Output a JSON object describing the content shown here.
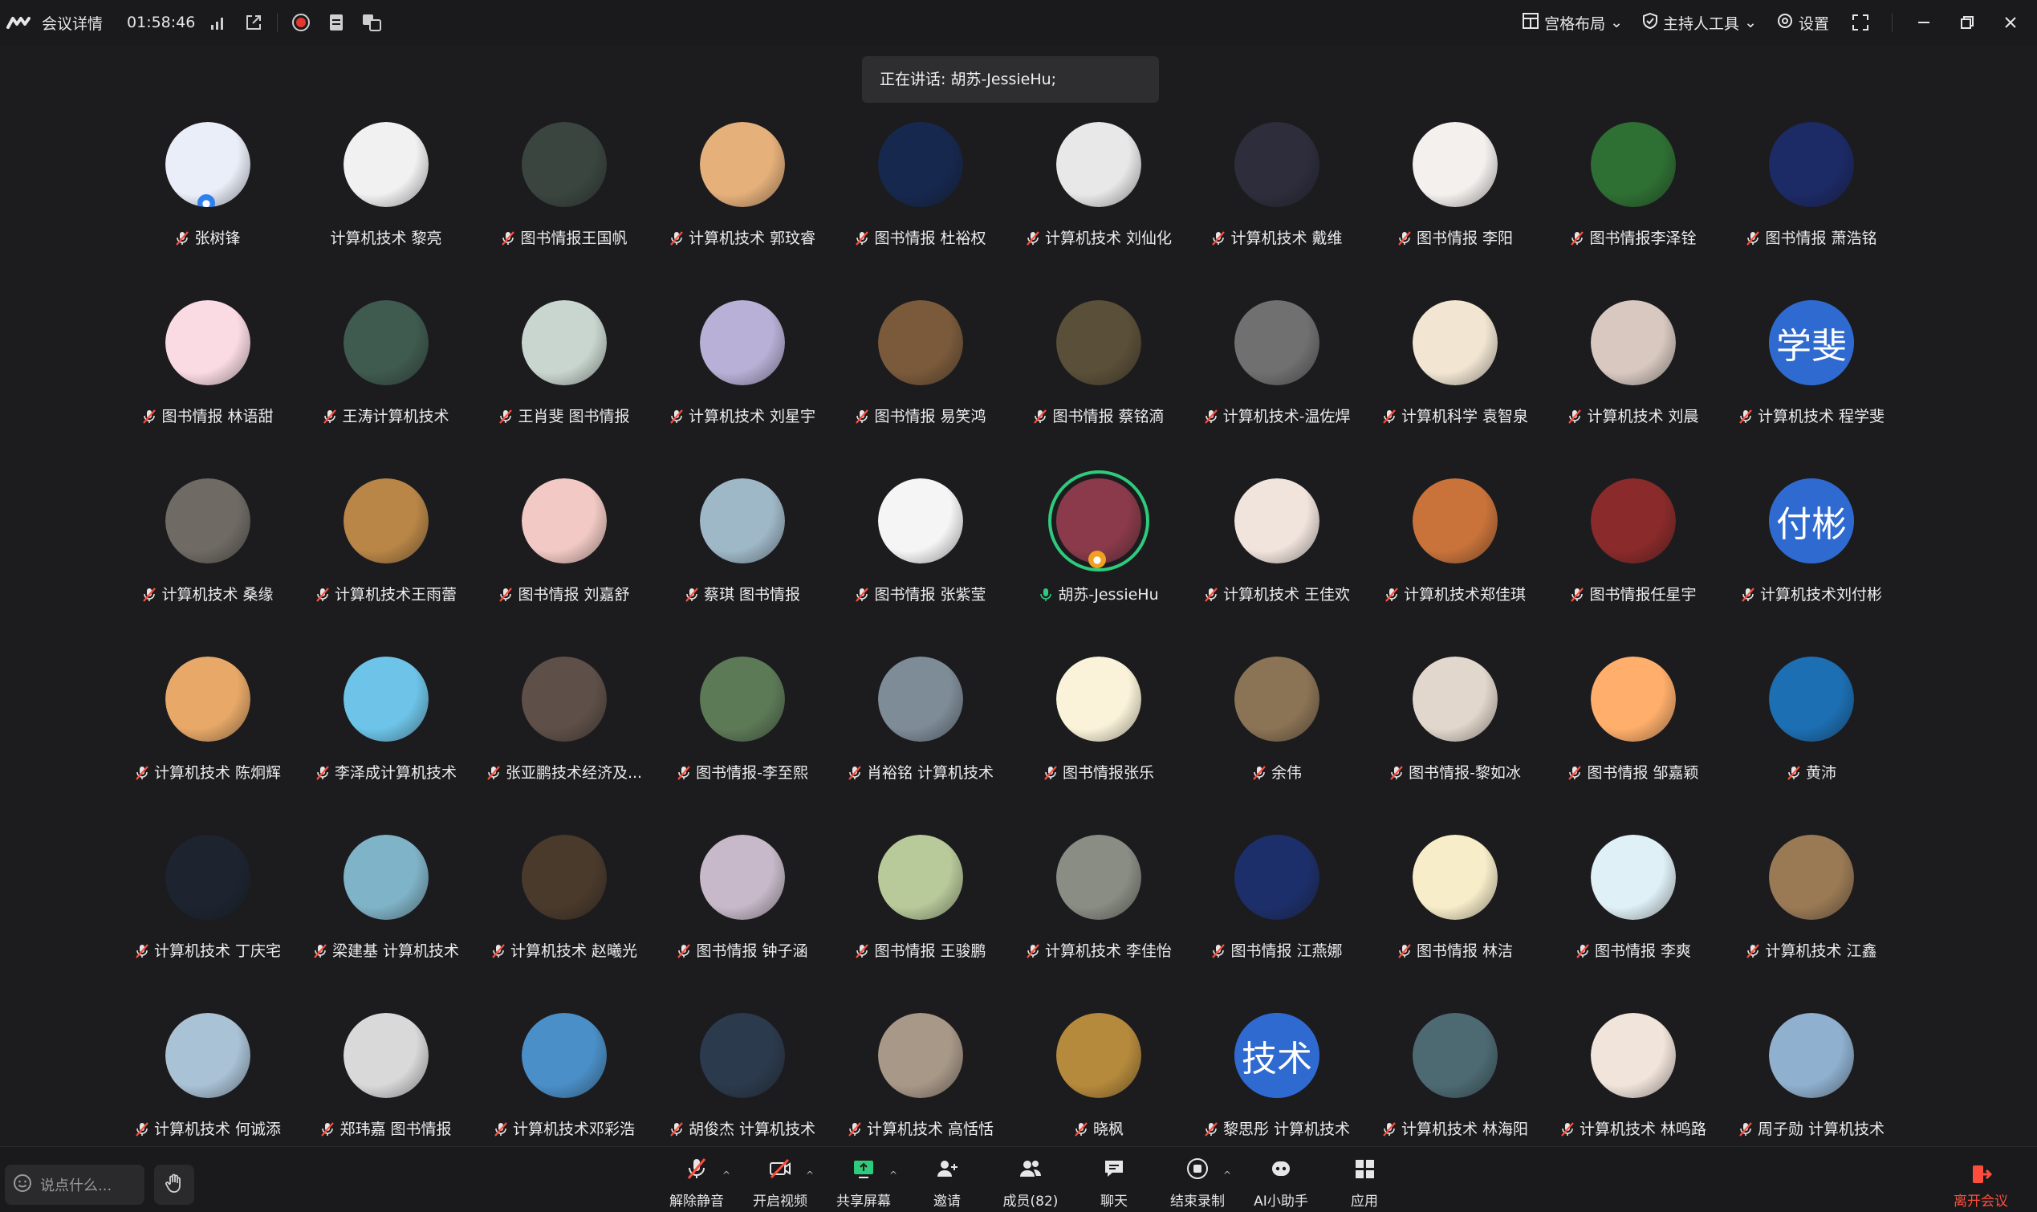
{
  "topbar": {
    "meeting_details": "会议详情",
    "timer": "01:58:46",
    "layout": "宫格布局",
    "host_tools": "主持人工具",
    "settings": "设置"
  },
  "speaking": "正在讲话: 胡苏-JessieHu;",
  "participants": [
    {
      "name": "张树锋",
      "avatar": "cat-pattern",
      "color": "#e9eef8",
      "muted": true,
      "host": true
    },
    {
      "name": "计算机技术 黎亮",
      "avatar": "sketch",
      "color": "#f1f1f1",
      "muted": false
    },
    {
      "name": "图书情报王国帆",
      "avatar": "photo",
      "color": "#3a4540",
      "muted": true
    },
    {
      "name": "计算机技术 郭玟睿",
      "avatar": "anime",
      "color": "#e6b07a",
      "muted": true
    },
    {
      "name": "图书情报 杜裕权",
      "avatar": "photo",
      "color": "#16284e",
      "muted": true
    },
    {
      "name": "计算机技术 刘仙化",
      "avatar": "duck",
      "color": "#e8e8e8",
      "muted": true
    },
    {
      "name": "计算机技术 戴维",
      "avatar": "robot",
      "color": "#2d2d3c",
      "muted": true
    },
    {
      "name": "图书情报 李阳",
      "avatar": "anime",
      "color": "#f3f0ee",
      "muted": true
    },
    {
      "name": "图书情报李泽铨",
      "avatar": "lotus",
      "color": "#2e6f33",
      "muted": true
    },
    {
      "name": "图书情报 萧浩铭",
      "avatar": "night",
      "color": "#1c2a66",
      "muted": true
    },
    {
      "name": "图书情报 林语甜",
      "avatar": "rabbit",
      "color": "#fbdbe3",
      "muted": true
    },
    {
      "name": "王涛计算机技术",
      "avatar": "panda",
      "color": "#3f5a4f",
      "muted": true
    },
    {
      "name": "王肖斐 图书情报",
      "avatar": "photo",
      "color": "#c9d6cf",
      "muted": true
    },
    {
      "name": "计算机技术 刘星宇",
      "avatar": "anime",
      "color": "#b8b0d6",
      "muted": true
    },
    {
      "name": "图书情报 易笑鸿",
      "avatar": "photo",
      "color": "#7a5a3b",
      "muted": true
    },
    {
      "name": "图书情报   蔡铭滴",
      "avatar": "photo",
      "color": "#5a4f38",
      "muted": true
    },
    {
      "name": "计算机技术-温佐焊",
      "avatar": "rail",
      "color": "#707070",
      "muted": true
    },
    {
      "name": "计算机科学 袁智泉",
      "avatar": "cartoon",
      "color": "#f2e6d3",
      "muted": true
    },
    {
      "name": "计算机技术 刘晨",
      "avatar": "photo",
      "color": "#d8c8c0",
      "muted": true
    },
    {
      "name": "计算机技术 程学斐",
      "avatar": "text",
      "text": "学斐",
      "color": "#2f6ad1",
      "muted": true
    },
    {
      "name": "计算机技术 桑缘",
      "avatar": "photo",
      "color": "#6f6a64",
      "muted": true
    },
    {
      "name": "计算机技术王雨蕾",
      "avatar": "bear",
      "color": "#b98647",
      "muted": true
    },
    {
      "name": "图书情报 刘嘉舒",
      "avatar": "baby",
      "color": "#f2c9c4",
      "muted": true
    },
    {
      "name": "蔡琪 图书情报",
      "avatar": "cat",
      "color": "#9fb8c8",
      "muted": true
    },
    {
      "name": "图书情报 张紫莹",
      "avatar": "tiger",
      "color": "#f5f5f5",
      "muted": true
    },
    {
      "name": "胡苏-JessieHu",
      "avatar": "photo",
      "color": "#8a3a4a",
      "muted": false,
      "active": true
    },
    {
      "name": "计算机技术 王佳欢",
      "avatar": "baby",
      "color": "#f1e4dd",
      "muted": true
    },
    {
      "name": "计算机技术郑佳琪",
      "avatar": "food",
      "color": "#c9733a",
      "muted": true
    },
    {
      "name": "图书情报任星宇",
      "avatar": "photo",
      "color": "#8a2a2a",
      "muted": true
    },
    {
      "name": "计算机技术刘付彬",
      "avatar": "text",
      "text": "付彬",
      "color": "#2f6ad1",
      "muted": true
    },
    {
      "name": "计算机技术 陈炯辉",
      "avatar": "cookie",
      "color": "#e7a868",
      "muted": true
    },
    {
      "name": "李泽成计算机技术",
      "avatar": "cartoon",
      "color": "#6dc4e8",
      "muted": true
    },
    {
      "name": "张亚鹏技术经济及...",
      "avatar": "photo",
      "color": "#5e5048",
      "muted": true
    },
    {
      "name": "图书情报-李至熙",
      "avatar": "photo",
      "color": "#5d7a57",
      "muted": true
    },
    {
      "name": "肖裕铭 计算机技术",
      "avatar": "cat",
      "color": "#7e8c97",
      "muted": true
    },
    {
      "name": "图书情报张乐",
      "avatar": "rabbit",
      "color": "#fbf3d9",
      "muted": true
    },
    {
      "name": "余伟",
      "avatar": "photo",
      "color": "#8b7355",
      "muted": true
    },
    {
      "name": "图书情报-黎如冰",
      "avatar": "photo",
      "color": "#e2d7cc",
      "muted": true
    },
    {
      "name": "图书情报 邹嘉颖",
      "avatar": "dog",
      "color": "#ffae6b",
      "muted": true
    },
    {
      "name": "黄沛",
      "avatar": "cartoon",
      "color": "#1c6fb3",
      "muted": true
    },
    {
      "name": "计算机技术 丁庆宅",
      "avatar": "photo",
      "color": "#1d2430",
      "muted": true
    },
    {
      "name": "梁建基 计算机技术",
      "avatar": "cloud",
      "color": "#7fb3c7",
      "muted": true
    },
    {
      "name": "计算机技术 赵曦光",
      "avatar": "dog",
      "color": "#4a3a2c",
      "muted": true
    },
    {
      "name": "图书情报 钟子涵",
      "avatar": "anime",
      "color": "#c7b9c9",
      "muted": true
    },
    {
      "name": "图书情报 王骏鹏",
      "avatar": "dog",
      "color": "#b8c99a",
      "muted": true
    },
    {
      "name": "计算机技术 李佳怡",
      "avatar": "photo",
      "color": "#8a8d84",
      "muted": true
    },
    {
      "name": "图书情报 江燕娜",
      "avatar": "photo",
      "color": "#1d2f6b",
      "muted": true
    },
    {
      "name": "图书情报 林洁",
      "avatar": "anime",
      "color": "#f7edc9",
      "muted": true
    },
    {
      "name": "图书情报 李爽",
      "avatar": "cartoon",
      "color": "#dff0f7",
      "muted": true
    },
    {
      "name": "计算机技术 江鑫",
      "avatar": "cat",
      "color": "#9a7a55",
      "muted": true
    },
    {
      "name": "计算机技术 何诚添",
      "avatar": "photo",
      "color": "#a9c2d6",
      "muted": true
    },
    {
      "name": "郑玮嘉 图书情报",
      "avatar": "photo",
      "color": "#d9d9d9",
      "muted": true
    },
    {
      "name": "计算机技术邓彩浩",
      "avatar": "cartoon",
      "color": "#4a8fc7",
      "muted": true
    },
    {
      "name": "胡俊杰 计算机技术",
      "avatar": "photo",
      "color": "#2b3a4c",
      "muted": true
    },
    {
      "name": "计算机技术 高恬恬",
      "avatar": "photo",
      "color": "#a89888",
      "muted": true
    },
    {
      "name": "晓枫",
      "avatar": "photo",
      "color": "#b68a3c",
      "muted": true
    },
    {
      "name": "黎思彤 计算机技术",
      "avatar": "text",
      "text": "技术",
      "color": "#2f6ad1",
      "muted": true
    },
    {
      "name": "计算机技术 林海阳",
      "avatar": "photo",
      "color": "#4d6a73",
      "muted": true
    },
    {
      "name": "计算机技术 林鸣路",
      "avatar": "cartoon",
      "color": "#f1e4da",
      "muted": true
    },
    {
      "name": "周子勋 计算机技术",
      "avatar": "anime",
      "color": "#8fb0cf",
      "muted": true
    }
  ],
  "bottombar": {
    "chat_placeholder": "说点什么...",
    "controls": [
      {
        "label": "解除静音",
        "icon": "mic-off-icon",
        "caret": true
      },
      {
        "label": "开启视频",
        "icon": "video-off-icon",
        "caret": true
      },
      {
        "label": "共享屏幕",
        "icon": "share-screen-icon",
        "caret": true
      },
      {
        "label": "邀请",
        "icon": "invite-icon",
        "caret": false
      },
      {
        "label": "成员(82)",
        "icon": "members-icon",
        "caret": false
      },
      {
        "label": "聊天",
        "icon": "chat-icon",
        "caret": false
      },
      {
        "label": "结束录制",
        "icon": "stop-record-icon",
        "caret": true
      },
      {
        "label": "AI小助手",
        "icon": "ai-assistant-icon",
        "caret": false
      },
      {
        "label": "应用",
        "icon": "apps-icon",
        "caret": false
      }
    ],
    "leave": "离开会议"
  }
}
